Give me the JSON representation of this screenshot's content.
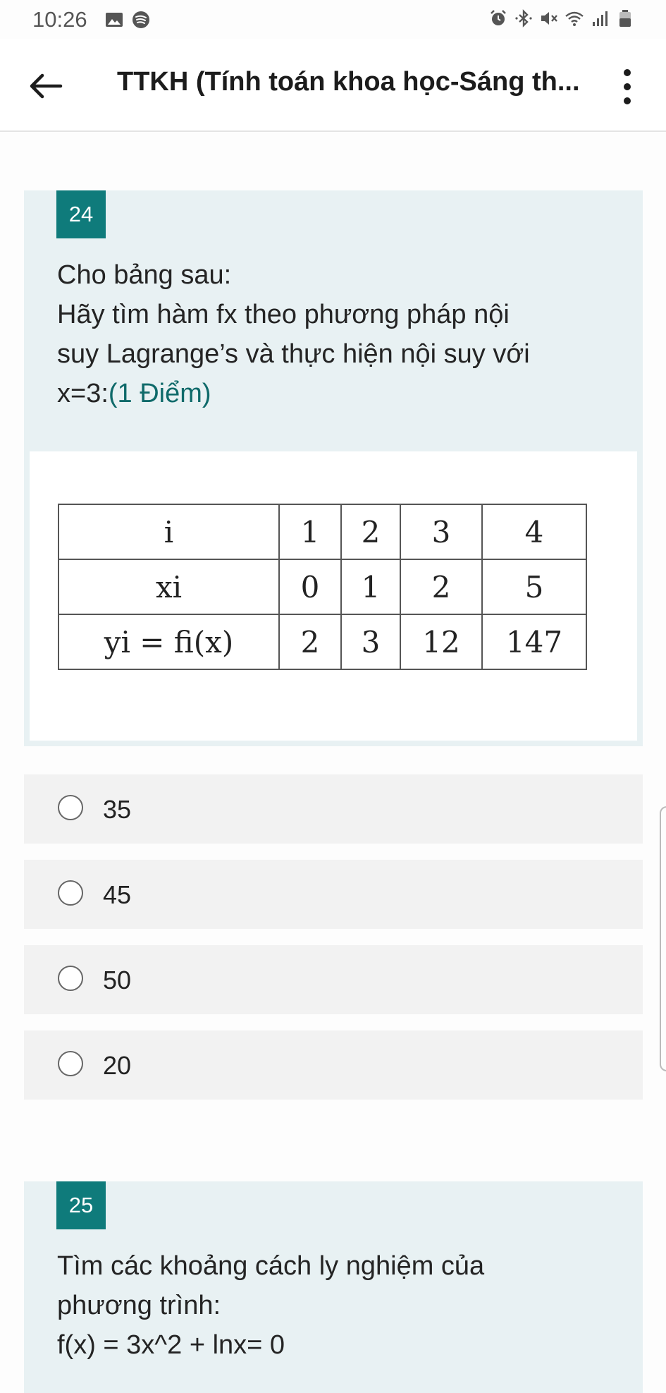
{
  "status_bar": {
    "time": "10:26",
    "left_icons": [
      "image-icon",
      "spotify-icon"
    ],
    "right_icons": [
      "alarm-icon",
      "bluetooth-icon",
      "mute-icon",
      "wifi-icon",
      "signal-icon",
      "battery-icon"
    ]
  },
  "app_bar": {
    "title": "TTKH (Tính toán khoa học-Sáng th...",
    "back_icon": "back-arrow-icon",
    "more_icon": "more-vert-icon"
  },
  "questions": [
    {
      "number": "24",
      "line1": "Cho bảng sau:",
      "line2": "Hãy tìm hàm fx theo phương pháp nội",
      "line3": "suy Lagrange’s và thực hiện nội suy với",
      "line4": "x=3:",
      "points": "(1 Điểm)",
      "table": {
        "rows": [
          [
            "i",
            "1",
            "2",
            "3",
            "4"
          ],
          [
            "xi",
            "0",
            "1",
            "2",
            "5"
          ],
          [
            "yi = fi(x)",
            "2",
            "3",
            "12",
            "147"
          ]
        ]
      },
      "options": [
        "35",
        "45",
        "50",
        "20"
      ]
    },
    {
      "number": "25",
      "line1": "Tìm các khoảng cách ly nghiệm của",
      "line2": "phương trình:",
      "line3": "f(x) = 3x^2 + lnx= 0"
    }
  ],
  "colors": {
    "accent": "#0f7b7b",
    "card_bg": "#e8f1f3",
    "option_bg": "#f2f2f2"
  }
}
